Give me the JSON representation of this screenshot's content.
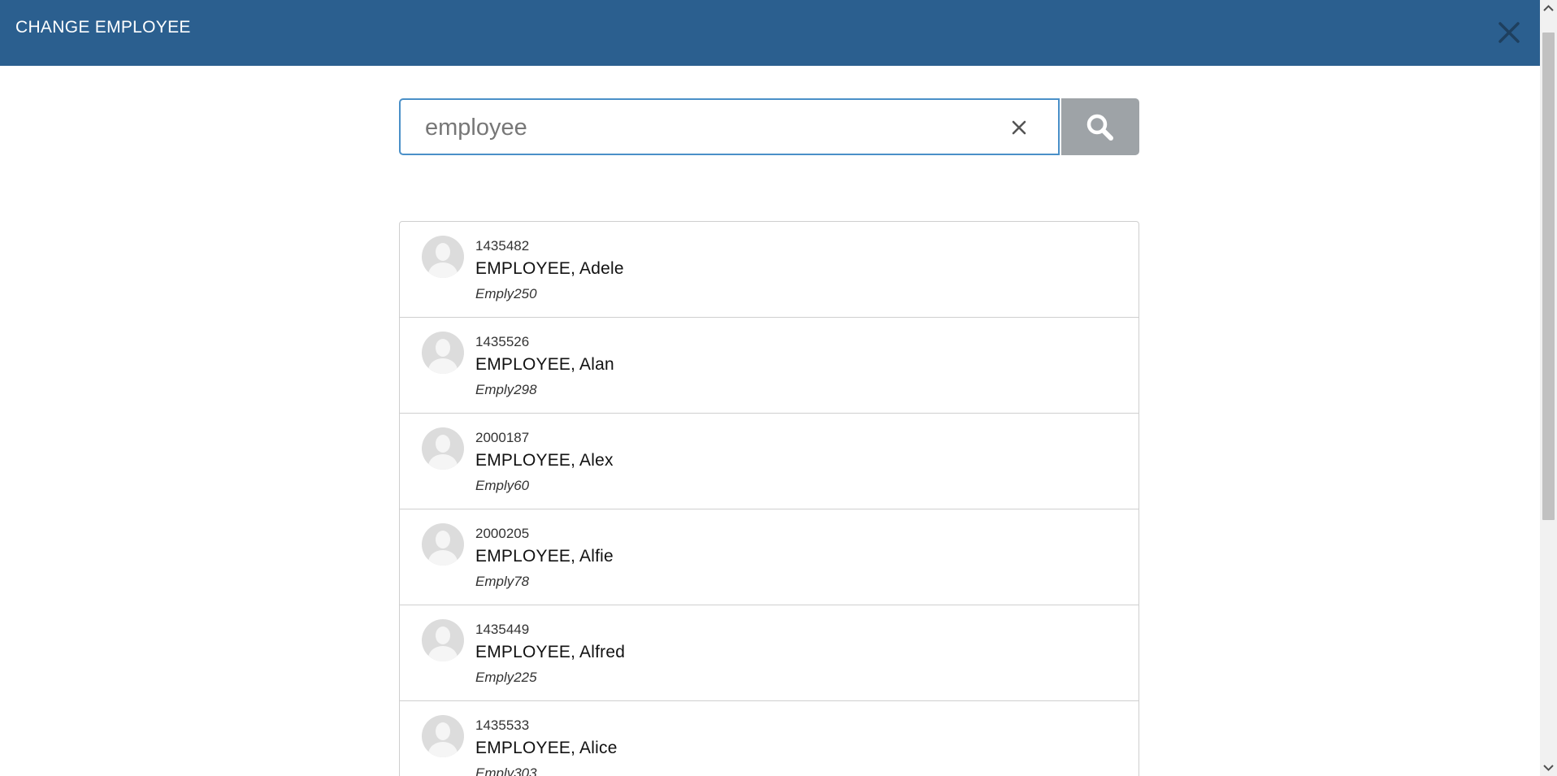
{
  "header": {
    "title": "CHANGE EMPLOYEE"
  },
  "search": {
    "value": "employee",
    "placeholder": ""
  },
  "results": [
    {
      "id": "1435482",
      "name": "EMPLOYEE, Adele",
      "code": "Emply250"
    },
    {
      "id": "1435526",
      "name": "EMPLOYEE, Alan",
      "code": "Emply298"
    },
    {
      "id": "2000187",
      "name": "EMPLOYEE, Alex",
      "code": "Emply60"
    },
    {
      "id": "2000205",
      "name": "EMPLOYEE, Alfie",
      "code": "Emply78"
    },
    {
      "id": "1435449",
      "name": "EMPLOYEE, Alfred",
      "code": "Emply225"
    },
    {
      "id": "1435533",
      "name": "EMPLOYEE, Alice",
      "code": "Emply303"
    }
  ],
  "colors": {
    "header_bg": "#2b5f8f",
    "search_border": "#4a90c8",
    "search_button_bg": "#9ea3a7"
  },
  "icons": {
    "close": "close-icon",
    "clear": "clear-icon",
    "search": "search-icon",
    "avatar": "avatar-icon"
  }
}
